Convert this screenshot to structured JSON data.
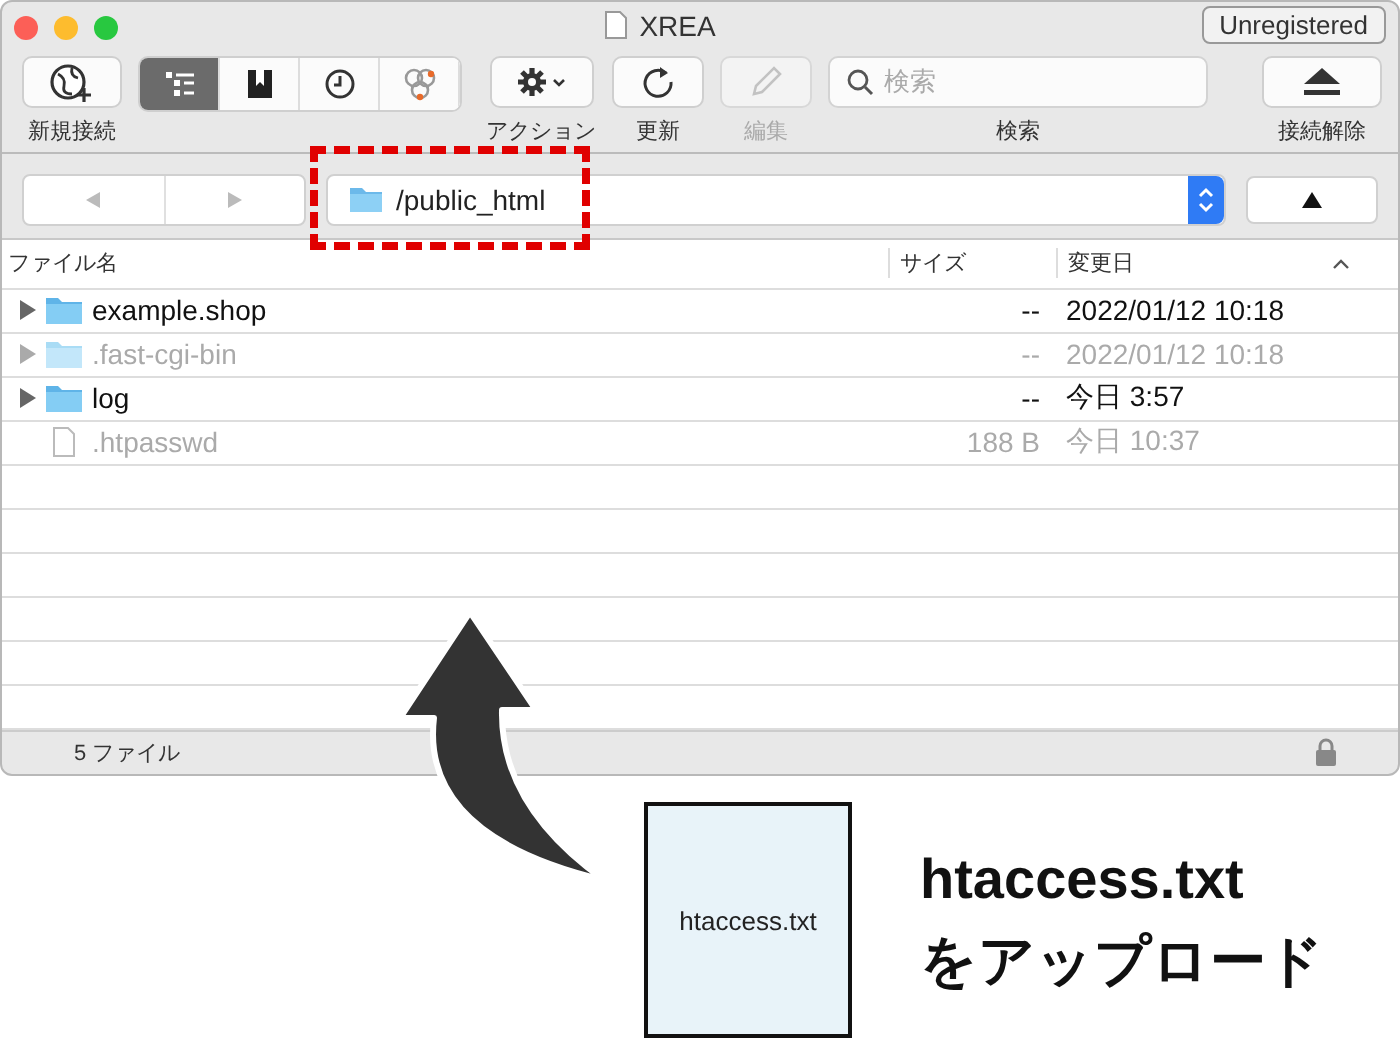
{
  "window": {
    "title": "XREA",
    "badge": "Unregistered"
  },
  "toolbar": [
    {
      "kind": "button",
      "label": "新規接続",
      "disabled": false
    },
    {
      "kind": "segments",
      "segments": [
        {
          "selected": true
        },
        {
          "selected": false
        },
        {
          "selected": false
        },
        {
          "selected": false
        }
      ]
    },
    {
      "kind": "button",
      "label": "アクション",
      "disabled": false
    },
    {
      "kind": "button",
      "label": "更新",
      "disabled": false
    },
    {
      "kind": "button",
      "label": "編集",
      "disabled": true
    },
    {
      "kind": "search",
      "placeholder": "検索",
      "label": "検索"
    },
    {
      "kind": "button",
      "label": "接続解除",
      "disabled": false
    }
  ],
  "path": {
    "value": "/public_html"
  },
  "table": {
    "columns": [
      "ファイル名",
      "サイズ",
      "変更日"
    ],
    "rows": [
      {
        "kind": "folder",
        "name": "example.shop",
        "size": "--",
        "modified": "2022/01/12 10:18",
        "dimmed": false
      },
      {
        "kind": "folder",
        "name": ".fast-cgi-bin",
        "size": "--",
        "modified": "2022/01/12 10:18",
        "dimmed": true
      },
      {
        "kind": "folder",
        "name": "log",
        "size": "--",
        "modified": "今日 3:57",
        "dimmed": false
      },
      {
        "kind": "file",
        "name": ".htpasswd",
        "size": "188 B",
        "modified": "今日 10:37",
        "dimmed": true
      }
    ]
  },
  "status_bar": {
    "text": "5 ファイル"
  },
  "annotation": {
    "file_label": "htaccess.txt",
    "caption": [
      "htaccess.txt",
      "をアップロード"
    ]
  }
}
